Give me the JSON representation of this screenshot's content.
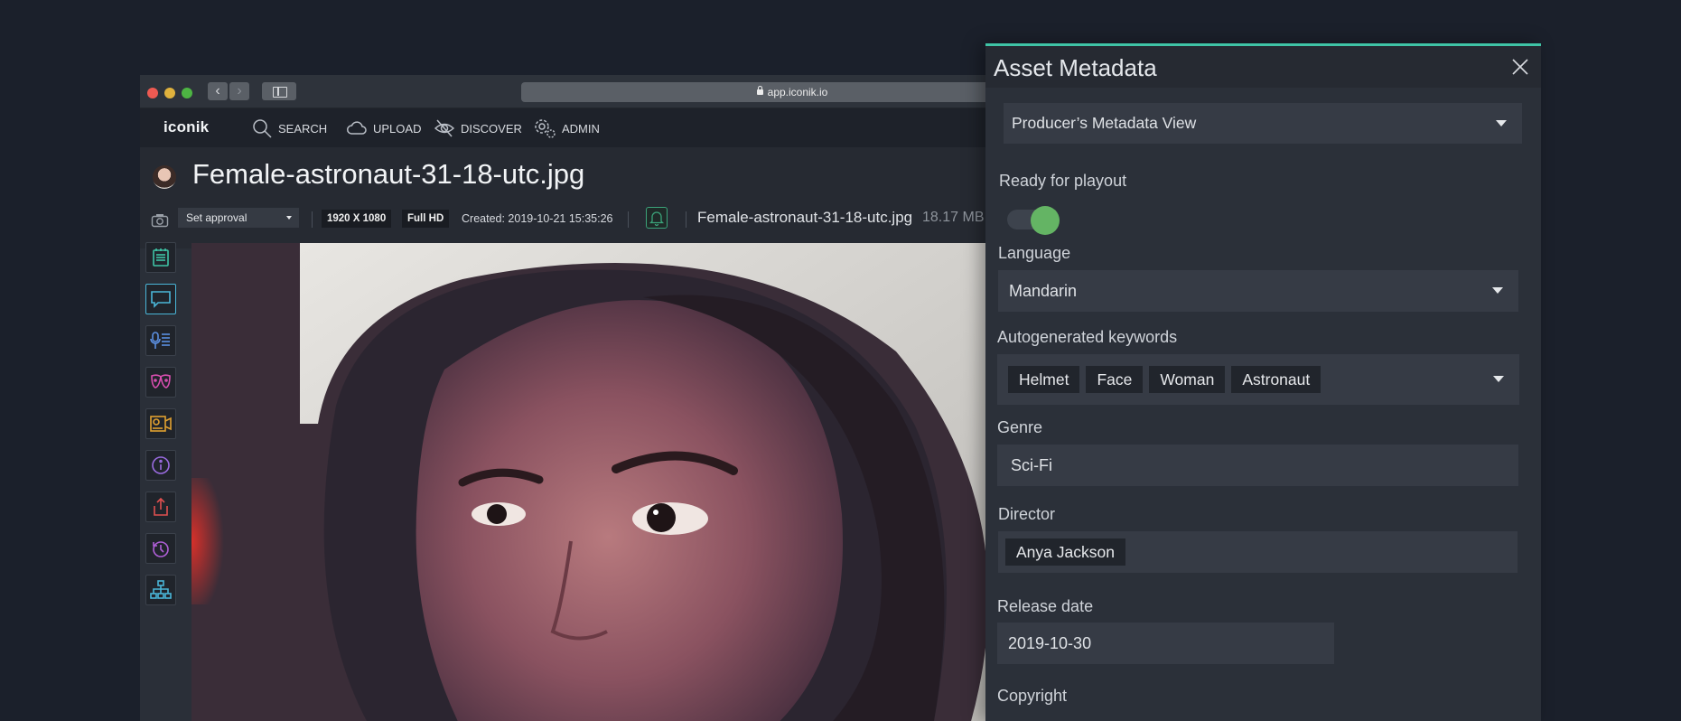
{
  "browser": {
    "url": "app.iconik.io",
    "back_glyph": "‹",
    "forward_glyph": "›"
  },
  "nav": {
    "logo": "iconik",
    "items": [
      {
        "label": "SEARCH",
        "icon": "search-icon"
      },
      {
        "label": "UPLOAD",
        "icon": "cloud-upload-icon"
      },
      {
        "label": "DISCOVER",
        "icon": "discover-icon"
      },
      {
        "label": "ADMIN",
        "icon": "gear-icon"
      }
    ]
  },
  "asset": {
    "title": "Female-astronaut-31-18-utc.jpg",
    "approval": "Set approval",
    "resolution": "1920 X 1080",
    "quality": "Full HD",
    "created": "Created: 2019-10-21 15:35:26",
    "filename": "Female-astronaut-31-18-utc.jpg",
    "filesize": "18.17 MB"
  },
  "tools": [
    {
      "icon": "notes-icon",
      "color": "#3fc4a6"
    },
    {
      "icon": "comment-icon",
      "color": "#4ab6d8"
    },
    {
      "icon": "transcript-icon",
      "color": "#5b8fe0"
    },
    {
      "icon": "faces-icon",
      "color": "#d94fb0"
    },
    {
      "icon": "video-segments-icon",
      "color": "#e0a030"
    },
    {
      "icon": "info-icon",
      "color": "#9a6be0"
    },
    {
      "icon": "share-icon",
      "color": "#e05050"
    },
    {
      "icon": "history-icon",
      "color": "#b05fd8"
    },
    {
      "icon": "hierarchy-icon",
      "color": "#4ab6d8"
    }
  ],
  "panel": {
    "title": "Asset Metadata",
    "view": "Producer’s Metadata View",
    "fields": {
      "ready_label": "Ready for playout",
      "ready_value": true,
      "language_label": "Language",
      "language_value": "Mandarin",
      "keywords_label": "Autogenerated keywords",
      "keywords": [
        "Helmet",
        "Face",
        "Woman",
        "Astronaut"
      ],
      "genre_label": "Genre",
      "genre_value": "Sci-Fi",
      "director_label": "Director",
      "director_value": "Anya Jackson",
      "release_label": "Release date",
      "release_value": "2019-10-30",
      "copyright_label": "Copyright"
    }
  },
  "colors": {
    "accent": "#3fc4a6",
    "toggle_on": "#64b464",
    "background": "#1b202b"
  }
}
